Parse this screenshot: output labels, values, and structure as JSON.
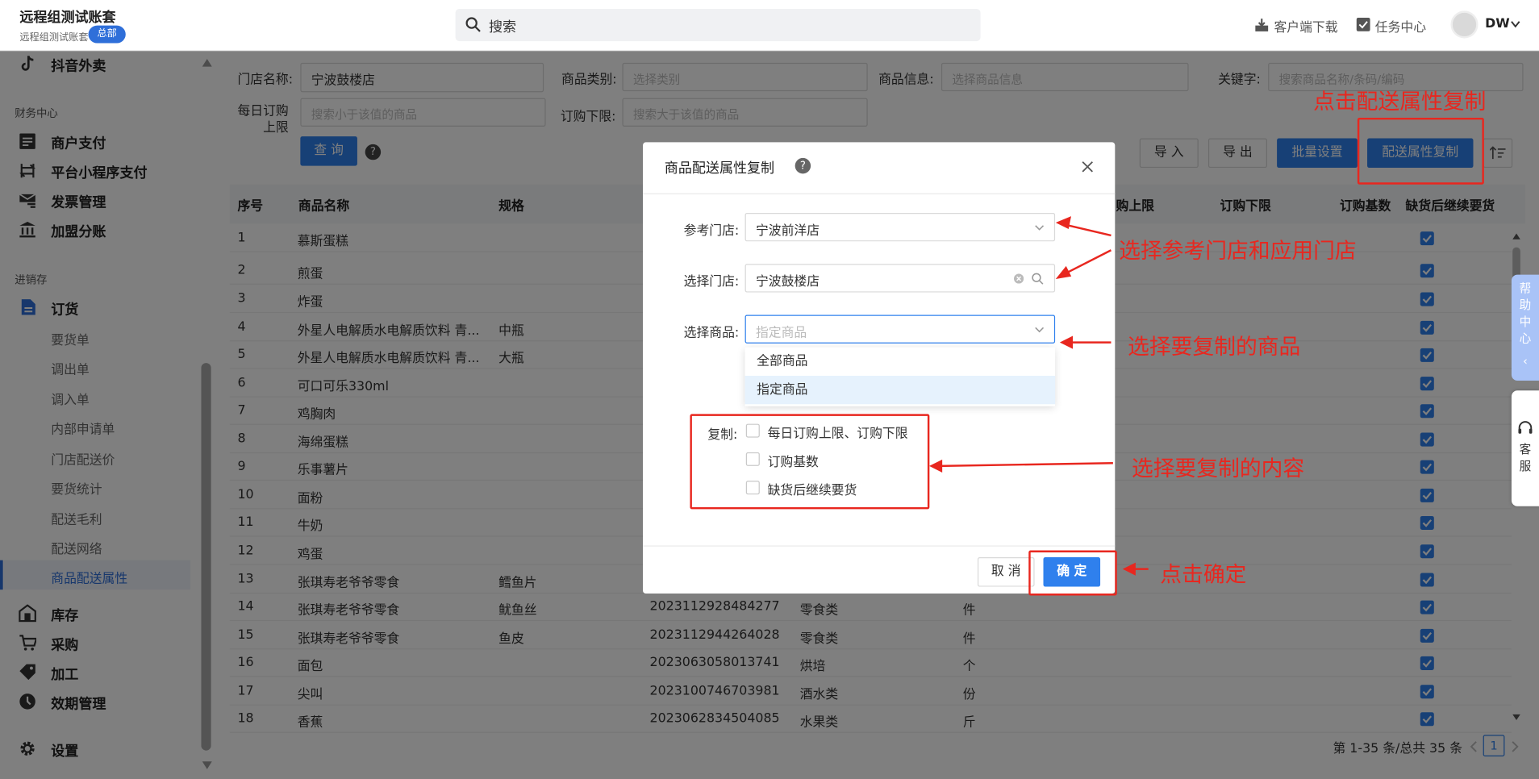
{
  "header": {
    "account_title": "远程组测试账套",
    "account_sub": "远程组测试账套",
    "hq_badge": "总部",
    "search_placeholder": "搜索",
    "client_download": "客户端下载",
    "task_center": "任务中心",
    "user": "DW"
  },
  "sidebar": {
    "top_item": "抖音外卖",
    "finance_section": "财务中心",
    "finance_items": [
      "商户支付",
      "平台小程序支付",
      "发票管理",
      "加盟分账"
    ],
    "inventory_section": "进销存",
    "order_group": "订货",
    "order_sub": [
      "要货单",
      "调出单",
      "调入单",
      "内部申请单",
      "门店配送价",
      "要货统计",
      "配送毛利",
      "配送网络",
      "商品配送属性"
    ],
    "bottom_items": [
      "库存",
      "采购",
      "加工",
      "效期管理"
    ],
    "settings": "设置"
  },
  "filters": {
    "store_label": "门店名称:",
    "store_value": "宁波鼓楼店",
    "category_label": "商品类别:",
    "category_placeholder": "选择类别",
    "goods_label": "商品信息:",
    "goods_placeholder": "选择商品信息",
    "keyword_label": "关键字:",
    "keyword_placeholder": "搜索商品名称/条码/编码",
    "daily_label_1": "每日订购",
    "daily_label_2": "上限",
    "daily_placeholder": "搜索小于该值的商品",
    "min_label": "订购下限:",
    "min_placeholder": "搜索大于该值的商品",
    "query_button": "查 询"
  },
  "toolbar": {
    "import": "导 入",
    "export": "导 出",
    "batch": "批量设置",
    "copy": "配送属性复制"
  },
  "table": {
    "headers": {
      "seq": "序号",
      "name": "商品名称",
      "spec": "规格",
      "max": "购上限",
      "min": "订购下限",
      "base": "订购基数",
      "continue": "缺货后继续要货"
    },
    "rows": [
      {
        "no": "1",
        "name": "慕斯蛋糕",
        "spec": "",
        "code": "",
        "cat": "",
        "unit": ""
      },
      {
        "no": "2",
        "name": "煎蛋",
        "spec": "",
        "code": "",
        "cat": "",
        "unit": ""
      },
      {
        "no": "3",
        "name": "炸蛋",
        "spec": "",
        "code": "",
        "cat": "",
        "unit": ""
      },
      {
        "no": "4",
        "name": "外星人电解质水电解质饮料 青...",
        "spec": "中瓶",
        "code": "",
        "cat": "",
        "unit": ""
      },
      {
        "no": "5",
        "name": "外星人电解质水电解质饮料 青...",
        "spec": "大瓶",
        "code": "",
        "cat": "",
        "unit": ""
      },
      {
        "no": "6",
        "name": "可口可乐330ml",
        "spec": "",
        "code": "",
        "cat": "",
        "unit": ""
      },
      {
        "no": "7",
        "name": "鸡胸肉",
        "spec": "",
        "code": "",
        "cat": "",
        "unit": ""
      },
      {
        "no": "8",
        "name": "海绵蛋糕",
        "spec": "",
        "code": "",
        "cat": "",
        "unit": ""
      },
      {
        "no": "9",
        "name": "乐事薯片",
        "spec": "",
        "code": "",
        "cat": "",
        "unit": ""
      },
      {
        "no": "10",
        "name": "面粉",
        "spec": "",
        "code": "",
        "cat": "",
        "unit": ""
      },
      {
        "no": "11",
        "name": "牛奶",
        "spec": "",
        "code": "",
        "cat": "",
        "unit": ""
      },
      {
        "no": "12",
        "name": "鸡蛋",
        "spec": "",
        "code": "",
        "cat": "",
        "unit": ""
      },
      {
        "no": "13",
        "name": "张琪寿老爷爷零食",
        "spec": "鳕鱼片",
        "code": "",
        "cat": "",
        "unit": ""
      },
      {
        "no": "14",
        "name": "张琪寿老爷爷零食",
        "spec": "鱿鱼丝",
        "code": "2023112928484277",
        "cat": "零食类",
        "unit": "件"
      },
      {
        "no": "15",
        "name": "张琪寿老爷爷零食",
        "spec": "鱼皮",
        "code": "2023112944264028",
        "cat": "零食类",
        "unit": "件"
      },
      {
        "no": "16",
        "name": "面包",
        "spec": "",
        "code": "2023063058013741",
        "cat": "烘培",
        "unit": "个"
      },
      {
        "no": "17",
        "name": "尖叫",
        "spec": "",
        "code": "2023100746703981",
        "cat": "酒水类",
        "unit": "份"
      },
      {
        "no": "18",
        "name": "香蕉",
        "spec": "",
        "code": "2023062834504085",
        "cat": "水果类",
        "unit": "斤"
      }
    ],
    "pagination_text": "第 1-35 条/总共 35 条",
    "current_page": "1"
  },
  "modal": {
    "title": "商品配送属性复制",
    "ref_store_label": "参考门店:",
    "ref_store_value": "宁波前洋店",
    "select_store_label": "选择门店:",
    "select_store_value": "宁波鼓楼店",
    "select_goods_label": "选择商品:",
    "select_goods_placeholder": "指定商品",
    "goods_options": [
      "全部商品",
      "指定商品"
    ],
    "copy_label": "复制:",
    "copy_options": [
      "每日订购上限、订购下限",
      "订购基数",
      "缺货后继续要货"
    ],
    "cancel": "取 消",
    "confirm": "确 定"
  },
  "annotations": {
    "a1": "点击配送属性复制",
    "a2": "选择参考门店和应用门店",
    "a3": "选择要复制的商品",
    "a4": "选择要复制的内容",
    "a5": "点击确定"
  },
  "floating": {
    "help": [
      "帮",
      "助",
      "中",
      "心",
      "‹"
    ],
    "service": [
      "客",
      "服"
    ]
  },
  "colors": {
    "primary": "#2f80ed",
    "annotation": "#e8271f",
    "mask": "rgba(0,0,0,0.5)"
  }
}
